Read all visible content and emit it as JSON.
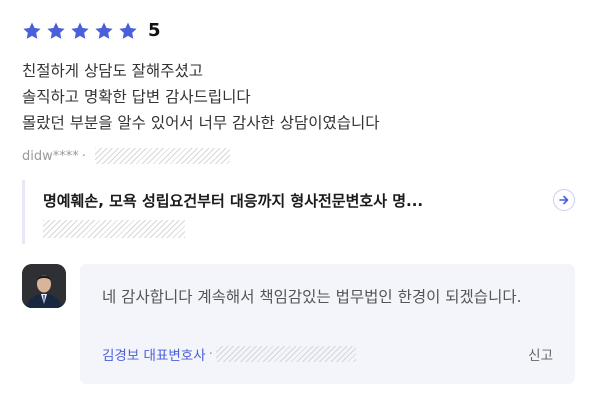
{
  "rating": {
    "stars": 5,
    "star_color": "#4a5fd9",
    "score": "5"
  },
  "review": {
    "lines": [
      "친절하게 상담도 잘해주셨고",
      "솔직하고 명확한 답변 감사드립니다",
      "몰랐던 부분을 알수 있어서 너무 감사한 상담이였습니다"
    ],
    "author": "didw****",
    "separator": "·"
  },
  "post": {
    "title": "명예훼손, 모욕 성립요건부터 대응까지 형사전문변호사 명..."
  },
  "reply": {
    "text": "네 감사합니다 계속해서 책임감있는 법무법인 한경이 되겠습니다.",
    "author": "김경보 대표변호사",
    "separator": "·",
    "report_label": "신고"
  }
}
